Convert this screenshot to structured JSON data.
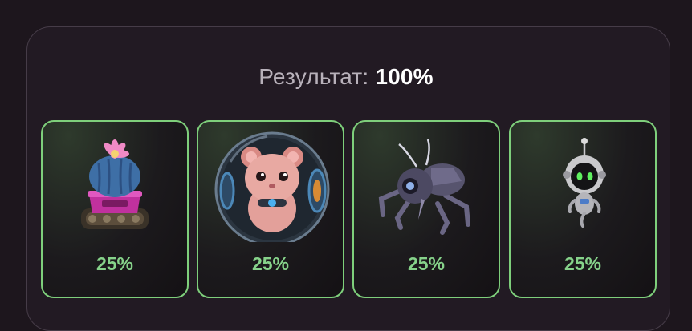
{
  "result": {
    "label": "Результат:",
    "value": "100%"
  },
  "cards": [
    {
      "icon": "cactus-tank-icon",
      "percent": "25%"
    },
    {
      "icon": "hamster-ball-icon",
      "percent": "25%"
    },
    {
      "icon": "robot-spider-icon",
      "percent": "25%"
    },
    {
      "icon": "robot-drone-icon",
      "percent": "25%"
    }
  ],
  "colors": {
    "background": "#1d161d",
    "panel_border": "#463c48",
    "card_border": "#7ecf7b",
    "percent_text": "#86d28a"
  }
}
